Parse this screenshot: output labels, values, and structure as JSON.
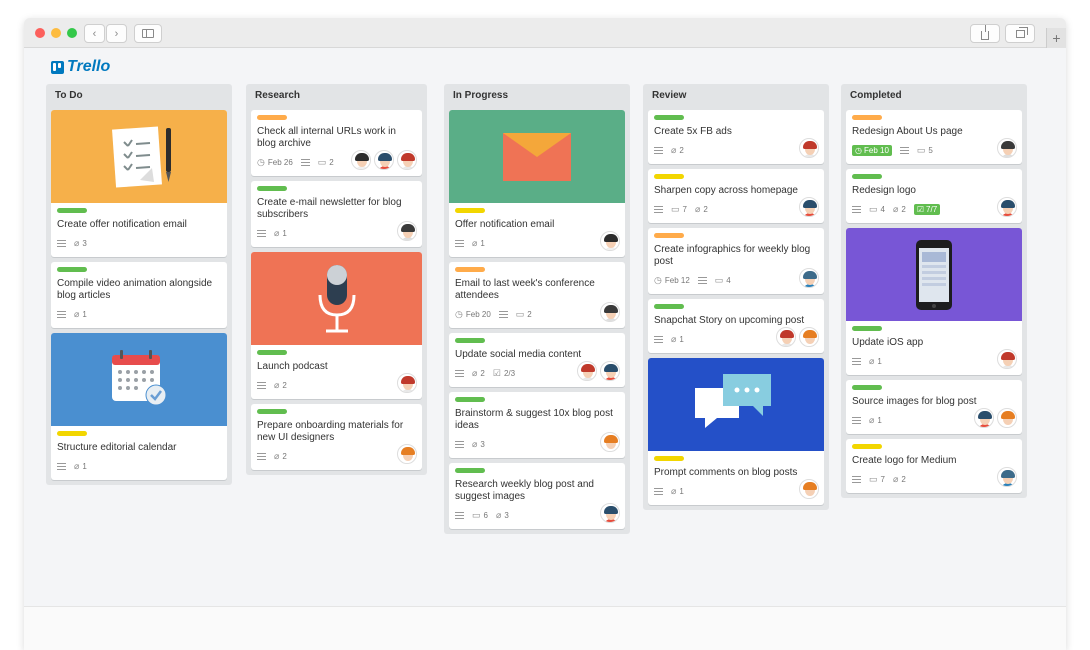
{
  "app": {
    "logo_text": "Trello"
  },
  "colors": {
    "green": "#61bd4f",
    "orange": "#ffab4a",
    "yellow": "#f2d600"
  },
  "lists": [
    {
      "title": "To Do",
      "cards": [
        {
          "cover": "document",
          "cover_color": "#f6b04a",
          "label": "#61bd4f",
          "title": "Create offer notification email",
          "attachments": "3",
          "members": []
        },
        {
          "label": "#61bd4f",
          "title": "Compile video animation alongside blog articles",
          "attachments": "1",
          "members": []
        },
        {
          "cover": "calendar",
          "cover_color": "#4a8fd0",
          "label": "#f2d600",
          "title": "Structure editorial calendar",
          "attachments": "1",
          "members": []
        }
      ]
    },
    {
      "title": "Research",
      "cards": [
        {
          "label": "#ffab4a",
          "title": "Check all internal URLs work in blog archive",
          "due": "Feb 26",
          "comments": "2",
          "members": [
            "a",
            "b",
            "c"
          ]
        },
        {
          "label": "#61bd4f",
          "title": "Create e-mail newsletter for blog subscribers",
          "attachments": "1",
          "members": [
            "d"
          ]
        },
        {
          "cover": "microphone",
          "cover_color": "#ef7355",
          "label": "#61bd4f",
          "title": "Launch podcast",
          "attachments": "2",
          "members": [
            "c"
          ]
        },
        {
          "label": "#61bd4f",
          "title": "Prepare onboarding materials for new UI designers",
          "attachments": "2",
          "members": [
            "e"
          ]
        }
      ]
    },
    {
      "title": "In Progress",
      "cards": [
        {
          "cover": "envelope",
          "cover_color": "#5aae87",
          "label": "#f2d600",
          "title": "Offer notification email",
          "attachments": "1",
          "members": [
            "a"
          ]
        },
        {
          "label": "#ffab4a",
          "title": "Email to last week's conference attendees",
          "due": "Feb 20",
          "comments": "2",
          "members": [
            "d"
          ]
        },
        {
          "label": "#61bd4f",
          "title": "Update social media content",
          "attachments": "2",
          "checklist": "2/3",
          "members": [
            "c",
            "b"
          ]
        },
        {
          "label": "#61bd4f",
          "title": "Brainstorm & suggest 10x blog post ideas",
          "attachments": "3",
          "members": [
            "e"
          ]
        },
        {
          "label": "#61bd4f",
          "title": "Research weekly blog post and suggest images",
          "attachments": "3",
          "comments": "6",
          "members": [
            "b"
          ]
        }
      ]
    },
    {
      "title": "Review",
      "cards": [
        {
          "label": "#61bd4f",
          "title": "Create 5x FB ads",
          "attachments": "2",
          "members": [
            "c"
          ]
        },
        {
          "label": "#f2d600",
          "title": "Sharpen copy across homepage",
          "comments": "7",
          "attachments": "2",
          "members": [
            "b"
          ]
        },
        {
          "label": "#ffab4a",
          "title": "Create infographics for weekly blog post",
          "due": "Feb 12",
          "comments": "4",
          "members": [
            "f"
          ]
        },
        {
          "label": "#61bd4f",
          "title": "Snapchat Story on upcoming post",
          "attachments": "1",
          "members": [
            "c",
            "e"
          ]
        },
        {
          "cover": "chat",
          "cover_color": "#2450c8",
          "label": "#f2d600",
          "title": "Prompt comments on blog posts",
          "attachments": "1",
          "members": [
            "e"
          ]
        }
      ]
    },
    {
      "title": "Completed",
      "cards": [
        {
          "label": "#ffab4a",
          "title": "Redesign About Us page",
          "due_done": "Feb 10",
          "comments": "5",
          "members": [
            "d"
          ]
        },
        {
          "label": "#61bd4f",
          "title": "Redesign logo",
          "comments": "4",
          "attachments": "2",
          "checklist_done": "7/7",
          "members": [
            "b"
          ]
        },
        {
          "cover": "phone",
          "cover_color": "#7856d6",
          "label": "#61bd4f",
          "title": "Update iOS app",
          "attachments": "1",
          "members": [
            "c"
          ]
        },
        {
          "label": "#61bd4f",
          "title": "Source images for blog post",
          "attachments": "1",
          "members": [
            "b",
            "e"
          ]
        },
        {
          "label": "#f2d600",
          "title": "Create logo for Medium",
          "comments": "7",
          "attachments": "2",
          "members": [
            "f"
          ]
        }
      ]
    }
  ]
}
